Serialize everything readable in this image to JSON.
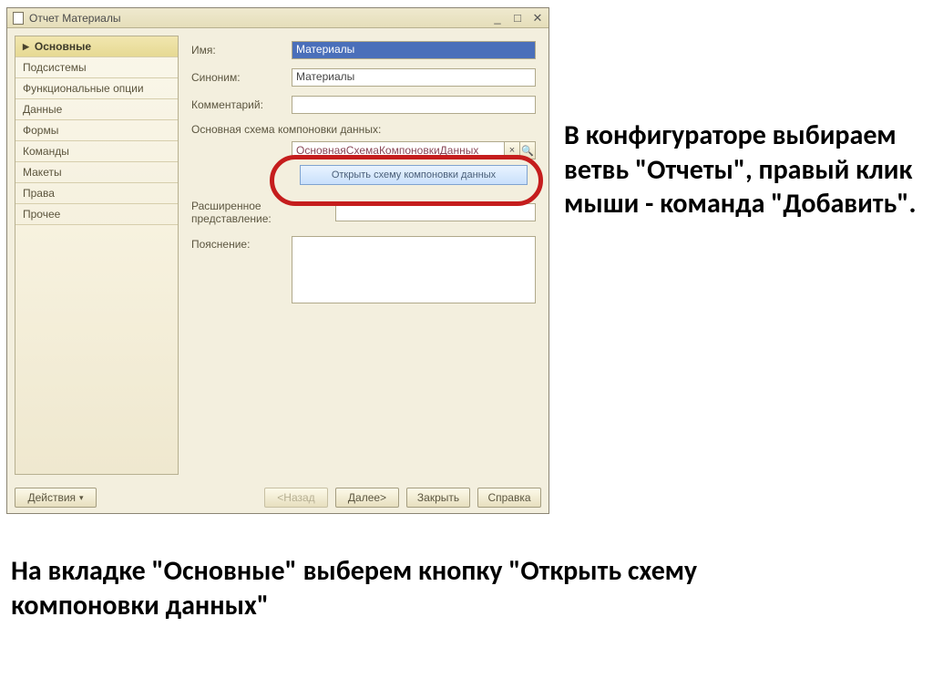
{
  "window": {
    "title": "Отчет Материалы"
  },
  "sidebar": {
    "items": [
      {
        "label": "Основные"
      },
      {
        "label": "Подсистемы"
      },
      {
        "label": "Функциональные опции"
      },
      {
        "label": "Данные"
      },
      {
        "label": "Формы"
      },
      {
        "label": "Команды"
      },
      {
        "label": "Макеты"
      },
      {
        "label": "Права"
      },
      {
        "label": "Прочее"
      }
    ]
  },
  "form": {
    "name_label": "Имя:",
    "name_value": "Материалы",
    "synonym_label": "Синоним:",
    "synonym_value": "Материалы",
    "comment_label": "Комментарий:",
    "comment_value": "",
    "schema_section_label": "Основная схема компоновки данных:",
    "schema_dropdown_value": "ОсновнаяСхемаКомпоновкиДанных",
    "open_schema_button": "Открыть схему компоновки данных",
    "extended_repr_label": "Расширенное представление:",
    "extended_repr_value": "",
    "explanation_label": "Пояснение:",
    "explanation_value": ""
  },
  "buttons": {
    "actions": "Действия",
    "back": "<Назад",
    "next": "Далее>",
    "close": "Закрыть",
    "help": "Справка"
  },
  "notes": {
    "side": "В конфигураторе выбираем ветвь \"Отчеты\", правый клик мыши - команда \"Добавить\".",
    "bottom": "На вкладке \"Основные\" выберем кнопку \"Открыть схему компоновки данных\""
  }
}
